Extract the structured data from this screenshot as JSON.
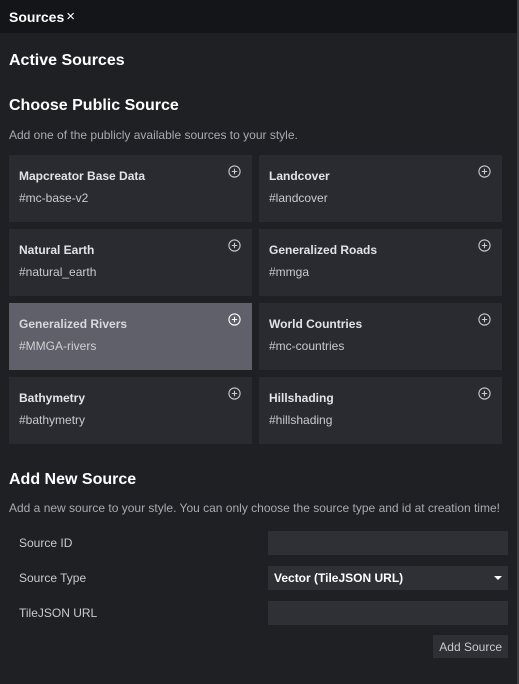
{
  "tab": {
    "title": "Sources",
    "close": "×"
  },
  "active_heading": "Active Sources",
  "public": {
    "heading": "Choose Public Source",
    "description": "Add one of the publicly available sources to your style.",
    "sources": [
      {
        "title": "Mapcreator Base Data",
        "id": "#mc-base-v2"
      },
      {
        "title": "Landcover",
        "id": "#landcover"
      },
      {
        "title": "Natural Earth",
        "id": "#natural_earth"
      },
      {
        "title": "Generalized Roads",
        "id": "#mmga"
      },
      {
        "title": "Generalized Rivers",
        "id": "#MMGA-rivers"
      },
      {
        "title": "World Countries",
        "id": "#mc-countries"
      },
      {
        "title": "Bathymetry",
        "id": "#bathymetry"
      },
      {
        "title": "Hillshading",
        "id": "#hillshading"
      }
    ],
    "selected_index": 4
  },
  "new_source": {
    "heading": "Add New Source",
    "description": "Add a new source to your style. You can only choose the source type and id at creation time!",
    "source_id_label": "Source ID",
    "source_id_value": "",
    "source_type_label": "Source Type",
    "source_type_value": "Vector (TileJSON URL)",
    "tilejson_label": "TileJSON URL",
    "tilejson_value": "",
    "add_button": "Add Source"
  },
  "icons": {
    "card_action": "plus-circle-icon",
    "select_caret": "caret-down-icon"
  }
}
